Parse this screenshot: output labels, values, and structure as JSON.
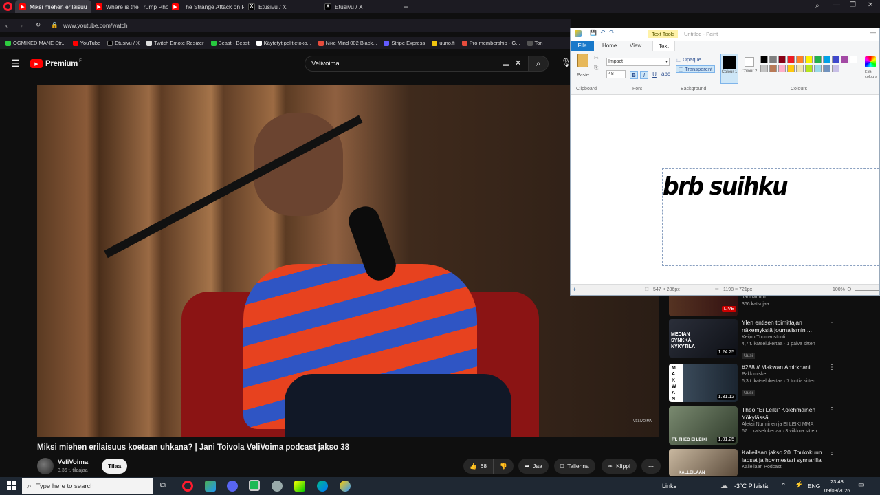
{
  "browser": {
    "tabs": [
      {
        "label": "Miksi miehen erilaisuu",
        "active": true,
        "icon": "youtube-icon"
      },
      {
        "label": "Where is the Trump Phone",
        "active": false,
        "icon": "youtube-icon"
      },
      {
        "label": "The Strange Attack on Fli",
        "active": false,
        "icon": "youtube-icon"
      },
      {
        "label": "Etusivu / X",
        "active": false,
        "icon": "x-icon"
      },
      {
        "label": "Etusivu / X",
        "active": false,
        "icon": "x-icon"
      }
    ],
    "url": "www.youtube.com/watch",
    "bookmarks": [
      "OGMIKEDIMANE Str...",
      "YouTube",
      "Etusivu / X",
      "Twitch Emote Resizer",
      "Beast - Beast",
      "Käytetyt pelitietoko...",
      "Nike Mind 002 Black...",
      "Stripe Express",
      "uuno.fi",
      "Pro membership - G...",
      "Ton"
    ]
  },
  "youtube": {
    "brand": "Premium",
    "brand_sup": "FI",
    "search_value": "Velivoima",
    "video_title": "Miksi miehen erilaisuus koetaan uhkana? | Jani Toivola VeliVoima podcast jakso 38",
    "channel_name": "VeliVoima",
    "subscribers": "3,36 t. tilaajaa",
    "subscribe_label": "Tilaa",
    "like_count": "68",
    "share_label": "Jaa",
    "save_label": "Tallenna",
    "clip_label": "Klippi",
    "watermark": "VELIVOIMA",
    "recs": [
      {
        "title": "Jani Munro",
        "meta1": "366 katsojaa",
        "meta2": "",
        "duration": "",
        "live": "LIVE",
        "new": ""
      },
      {
        "title": "Ylen entisen toimittajan näkemyksiä journalismin ...",
        "meta1": "Keijon Tuumaustunti",
        "meta2": "4,7 t. katselukertaa · 1 päivä sitten",
        "duration": "1.24.25",
        "live": "",
        "new": "Uusi",
        "thumb_text": "MEDIAN SYNKKÄ NYKYTILA"
      },
      {
        "title": "#288 // Makwan Amirkhani",
        "meta1": "Pakkimiske",
        "meta2": "6,3 t. katselukertaa · 7 tuntia sitten",
        "duration": "1.31.12",
        "live": "",
        "new": "Uusi",
        "thumb_text": "MAKWAN"
      },
      {
        "title": "Theo \"Ei Leiki\" Kolehmainen Yökylässä",
        "meta1": "Aleksi Nurminen ja EI LEIKI MMA",
        "meta2": "67 t. katselukertaa · 3 viikkoa sitten",
        "duration": "1.01.25",
        "live": "",
        "new": "",
        "thumb_text": "FT. THEO EI LEIKI"
      },
      {
        "title": "Kalleilaan jakso 20. Toukokuun lapset ja hovimestari synnarilla",
        "meta1": "Kalleilaan Podcast",
        "meta2": "",
        "duration": "",
        "live": "",
        "new": "",
        "thumb_text": "KALLEILAAN"
      }
    ]
  },
  "paint": {
    "title": "Untitled - Paint",
    "context_tab": "Text Tools",
    "tabs": [
      "File",
      "Home",
      "View",
      "Text"
    ],
    "font_name": "Impact",
    "font_size": "48",
    "opaque_label": "Opaque",
    "transparent_label": "Transparent",
    "paste_label": "Paste",
    "colour1_label": "Colour 1",
    "colour2_label": "Colour 2",
    "edit_colours_label": "Edit colours",
    "groups": [
      "Clipboard",
      "Font",
      "Background",
      "Colours"
    ],
    "canvas_text": "brb suihku",
    "status_selection": "547 × 286px",
    "status_size": "1198 × 721px",
    "zoom": "100%",
    "palette": [
      "#000000",
      "#7f7f7f",
      "#880015",
      "#ed1c24",
      "#ff7f27",
      "#fff200",
      "#22b14c",
      "#00a2e8",
      "#3f48cc",
      "#a349a4",
      "#ffffff",
      "#c3c3c3",
      "#b97a57",
      "#ffaec9",
      "#ffc90e",
      "#efe4b0",
      "#b5e61d",
      "#99d9ea",
      "#7092be",
      "#c8bfe7"
    ]
  },
  "taskbar": {
    "search_placeholder": "Type here to search",
    "links_label": "Links",
    "weather": "-3°C  Pilvistä",
    "lang": "ENG",
    "time": "23.43",
    "date": "09/03/2026"
  }
}
